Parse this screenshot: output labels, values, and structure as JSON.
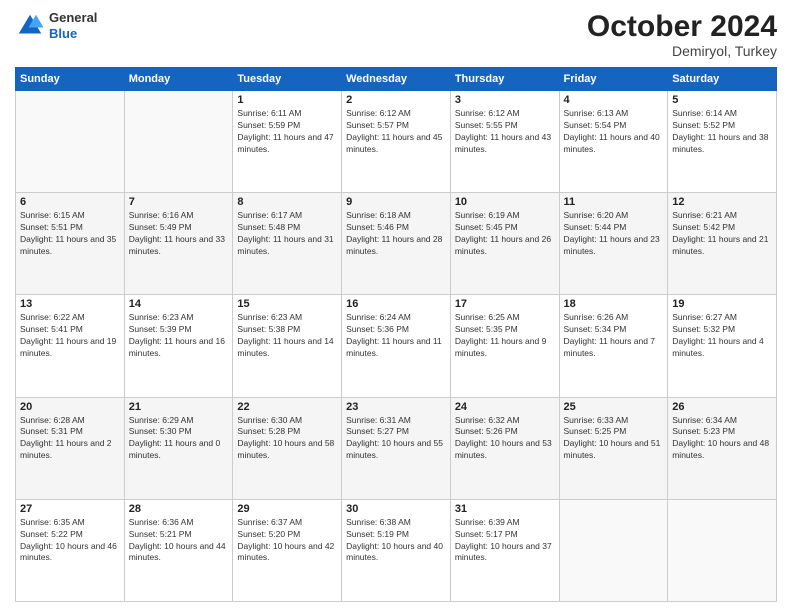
{
  "header": {
    "logo": {
      "line1": "General",
      "line2": "Blue"
    },
    "title": "October 2024",
    "location": "Demiryol, Turkey"
  },
  "weekdays": [
    "Sunday",
    "Monday",
    "Tuesday",
    "Wednesday",
    "Thursday",
    "Friday",
    "Saturday"
  ],
  "weeks": [
    [
      {
        "day": "",
        "info": ""
      },
      {
        "day": "",
        "info": ""
      },
      {
        "day": "1",
        "info": "Sunrise: 6:11 AM\nSunset: 5:59 PM\nDaylight: 11 hours and 47 minutes."
      },
      {
        "day": "2",
        "info": "Sunrise: 6:12 AM\nSunset: 5:57 PM\nDaylight: 11 hours and 45 minutes."
      },
      {
        "day": "3",
        "info": "Sunrise: 6:12 AM\nSunset: 5:55 PM\nDaylight: 11 hours and 43 minutes."
      },
      {
        "day": "4",
        "info": "Sunrise: 6:13 AM\nSunset: 5:54 PM\nDaylight: 11 hours and 40 minutes."
      },
      {
        "day": "5",
        "info": "Sunrise: 6:14 AM\nSunset: 5:52 PM\nDaylight: 11 hours and 38 minutes."
      }
    ],
    [
      {
        "day": "6",
        "info": "Sunrise: 6:15 AM\nSunset: 5:51 PM\nDaylight: 11 hours and 35 minutes."
      },
      {
        "day": "7",
        "info": "Sunrise: 6:16 AM\nSunset: 5:49 PM\nDaylight: 11 hours and 33 minutes."
      },
      {
        "day": "8",
        "info": "Sunrise: 6:17 AM\nSunset: 5:48 PM\nDaylight: 11 hours and 31 minutes."
      },
      {
        "day": "9",
        "info": "Sunrise: 6:18 AM\nSunset: 5:46 PM\nDaylight: 11 hours and 28 minutes."
      },
      {
        "day": "10",
        "info": "Sunrise: 6:19 AM\nSunset: 5:45 PM\nDaylight: 11 hours and 26 minutes."
      },
      {
        "day": "11",
        "info": "Sunrise: 6:20 AM\nSunset: 5:44 PM\nDaylight: 11 hours and 23 minutes."
      },
      {
        "day": "12",
        "info": "Sunrise: 6:21 AM\nSunset: 5:42 PM\nDaylight: 11 hours and 21 minutes."
      }
    ],
    [
      {
        "day": "13",
        "info": "Sunrise: 6:22 AM\nSunset: 5:41 PM\nDaylight: 11 hours and 19 minutes."
      },
      {
        "day": "14",
        "info": "Sunrise: 6:23 AM\nSunset: 5:39 PM\nDaylight: 11 hours and 16 minutes."
      },
      {
        "day": "15",
        "info": "Sunrise: 6:23 AM\nSunset: 5:38 PM\nDaylight: 11 hours and 14 minutes."
      },
      {
        "day": "16",
        "info": "Sunrise: 6:24 AM\nSunset: 5:36 PM\nDaylight: 11 hours and 11 minutes."
      },
      {
        "day": "17",
        "info": "Sunrise: 6:25 AM\nSunset: 5:35 PM\nDaylight: 11 hours and 9 minutes."
      },
      {
        "day": "18",
        "info": "Sunrise: 6:26 AM\nSunset: 5:34 PM\nDaylight: 11 hours and 7 minutes."
      },
      {
        "day": "19",
        "info": "Sunrise: 6:27 AM\nSunset: 5:32 PM\nDaylight: 11 hours and 4 minutes."
      }
    ],
    [
      {
        "day": "20",
        "info": "Sunrise: 6:28 AM\nSunset: 5:31 PM\nDaylight: 11 hours and 2 minutes."
      },
      {
        "day": "21",
        "info": "Sunrise: 6:29 AM\nSunset: 5:30 PM\nDaylight: 11 hours and 0 minutes."
      },
      {
        "day": "22",
        "info": "Sunrise: 6:30 AM\nSunset: 5:28 PM\nDaylight: 10 hours and 58 minutes."
      },
      {
        "day": "23",
        "info": "Sunrise: 6:31 AM\nSunset: 5:27 PM\nDaylight: 10 hours and 55 minutes."
      },
      {
        "day": "24",
        "info": "Sunrise: 6:32 AM\nSunset: 5:26 PM\nDaylight: 10 hours and 53 minutes."
      },
      {
        "day": "25",
        "info": "Sunrise: 6:33 AM\nSunset: 5:25 PM\nDaylight: 10 hours and 51 minutes."
      },
      {
        "day": "26",
        "info": "Sunrise: 6:34 AM\nSunset: 5:23 PM\nDaylight: 10 hours and 48 minutes."
      }
    ],
    [
      {
        "day": "27",
        "info": "Sunrise: 6:35 AM\nSunset: 5:22 PM\nDaylight: 10 hours and 46 minutes."
      },
      {
        "day": "28",
        "info": "Sunrise: 6:36 AM\nSunset: 5:21 PM\nDaylight: 10 hours and 44 minutes."
      },
      {
        "day": "29",
        "info": "Sunrise: 6:37 AM\nSunset: 5:20 PM\nDaylight: 10 hours and 42 minutes."
      },
      {
        "day": "30",
        "info": "Sunrise: 6:38 AM\nSunset: 5:19 PM\nDaylight: 10 hours and 40 minutes."
      },
      {
        "day": "31",
        "info": "Sunrise: 6:39 AM\nSunset: 5:17 PM\nDaylight: 10 hours and 37 minutes."
      },
      {
        "day": "",
        "info": ""
      },
      {
        "day": "",
        "info": ""
      }
    ]
  ]
}
